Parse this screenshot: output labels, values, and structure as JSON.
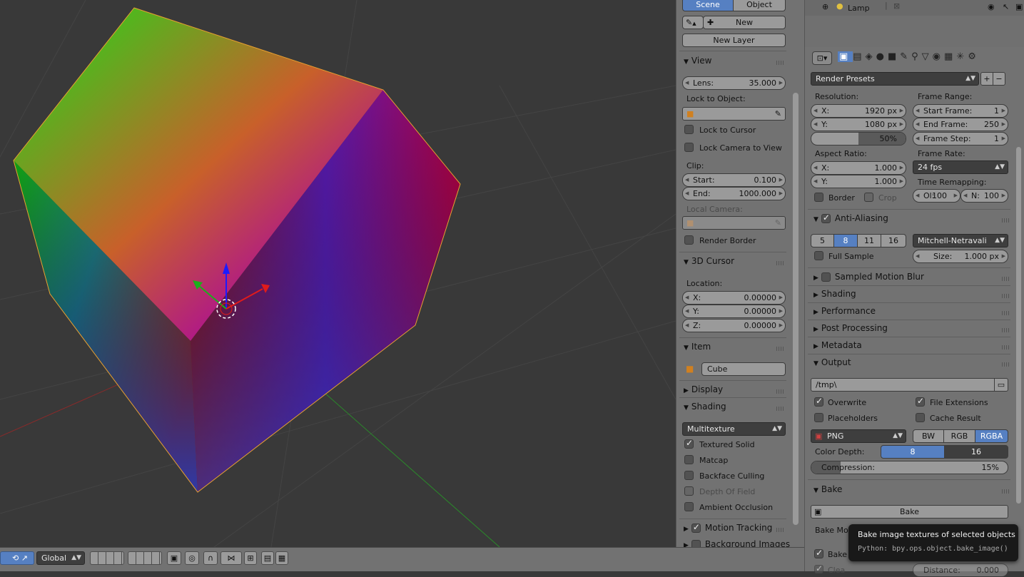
{
  "outliner": {
    "lamp_label": "Lamp"
  },
  "npanel": {
    "tabs": [
      "Scene",
      "Object"
    ],
    "new_label": "New",
    "new_layer_label": "New Layer",
    "view": {
      "title": "View",
      "lens_label": "Lens:",
      "lens_value": "35.000",
      "lock_to_object": "Lock to Object:",
      "lock_to_cursor": "Lock to Cursor",
      "lock_camera": "Lock Camera to View",
      "clip": "Clip:",
      "start_label": "Start:",
      "start_value": "0.100",
      "end_label": "End:",
      "end_value": "1000.000",
      "local_camera": "Local Camera:",
      "render_border": "Render Border"
    },
    "cursor": {
      "title": "3D Cursor",
      "location": "Location:",
      "x_label": "X:",
      "x_value": "0.00000",
      "y_label": "Y:",
      "y_value": "0.00000",
      "z_label": "Z:",
      "z_value": "0.00000"
    },
    "item": {
      "title": "Item",
      "name": "Cube"
    },
    "display": {
      "title": "Display"
    },
    "shading": {
      "title": "Shading",
      "mode": "Multitexture",
      "textured_solid": "Textured Solid",
      "matcap": "Matcap",
      "backface": "Backface Culling",
      "dof": "Depth Of Field",
      "ao": "Ambient Occlusion"
    },
    "motion_tracking": "Motion Tracking",
    "background_images": "Background Images"
  },
  "header": {
    "orientation": "Global"
  },
  "render": {
    "presets": "Render Presets",
    "resolution": "Resolution:",
    "res_x_label": "X:",
    "res_x": "1920 px",
    "res_y_label": "Y:",
    "res_y": "1080 px",
    "res_pct": "50%",
    "res_pct_fraction": 0.5,
    "frame_range": "Frame Range:",
    "start_frame_label": "Start Frame:",
    "start_frame": "1",
    "end_frame_label": "End Frame:",
    "end_frame": "250",
    "frame_step_label": "Frame Step:",
    "frame_step": "1",
    "aspect": "Aspect Ratio:",
    "asp_x_label": "X:",
    "asp_x": "1.000",
    "asp_y_label": "Y:",
    "asp_y": "1.000",
    "frame_rate": "Frame Rate:",
    "fps": "24 fps",
    "time_remap": "Time Remapping:",
    "old_label": "Ol:",
    "old": "100",
    "new_label": "N:",
    "new": "100",
    "border": "Border",
    "crop": "Crop",
    "aa": {
      "title": "Anti-Aliasing",
      "samples": [
        "5",
        "8",
        "11",
        "16"
      ],
      "filter": "Mitchell-Netravali",
      "full_sample": "Full Sample",
      "size_label": "Size:",
      "size": "1.000 px"
    },
    "sections": [
      "Sampled Motion Blur",
      "Shading",
      "Performance",
      "Post Processing",
      "Metadata"
    ],
    "output": {
      "title": "Output",
      "path": "/tmp\\",
      "overwrite": "Overwrite",
      "file_ext": "File Extensions",
      "placeholders": "Placeholders",
      "cache": "Cache Result",
      "format": "PNG",
      "color_modes": [
        "BW",
        "RGB",
        "RGBA"
      ],
      "color_depth": "Color Depth:",
      "depths": [
        "8",
        "16"
      ],
      "compression_label": "Compression:",
      "compression": "15%",
      "compression_fraction": 0.15
    },
    "bake": {
      "title": "Bake",
      "button": "Bake",
      "mode_label": "Bake Mo",
      "selected": "Bake t",
      "clear": "Clea",
      "distance": "Distance:",
      "distance_value": "0.000"
    }
  },
  "tooltip": {
    "title": "Bake image textures of selected objects",
    "python": "Python: bpy.ops.object.bake_image()"
  },
  "colors": {
    "accent": "#5680c2",
    "panel": "#727272",
    "viewport": "#393939"
  }
}
